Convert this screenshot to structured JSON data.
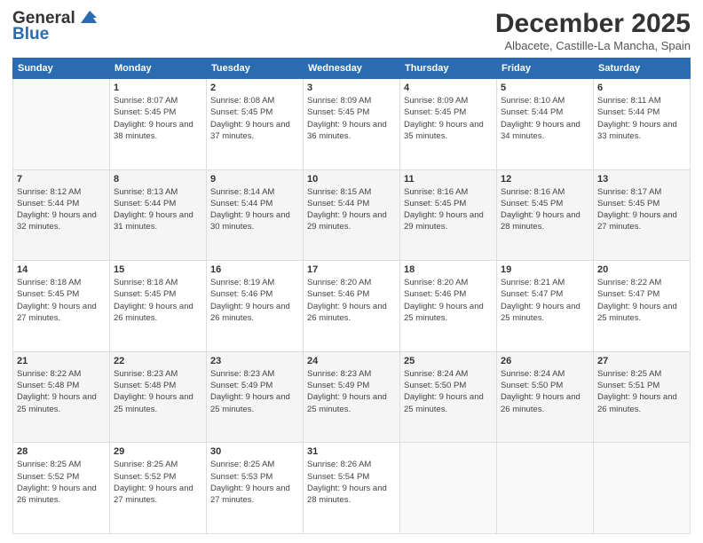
{
  "header": {
    "logo_line1": "General",
    "logo_line2": "Blue",
    "month_title": "December 2025",
    "location": "Albacete, Castille-La Mancha, Spain"
  },
  "weekdays": [
    "Sunday",
    "Monday",
    "Tuesday",
    "Wednesday",
    "Thursday",
    "Friday",
    "Saturday"
  ],
  "weeks": [
    [
      {
        "day": "",
        "sunrise": "",
        "sunset": "",
        "daylight": "",
        "empty": true
      },
      {
        "day": "1",
        "sunrise": "8:07 AM",
        "sunset": "5:45 PM",
        "daylight": "9 hours and 38 minutes."
      },
      {
        "day": "2",
        "sunrise": "8:08 AM",
        "sunset": "5:45 PM",
        "daylight": "9 hours and 37 minutes."
      },
      {
        "day": "3",
        "sunrise": "8:09 AM",
        "sunset": "5:45 PM",
        "daylight": "9 hours and 36 minutes."
      },
      {
        "day": "4",
        "sunrise": "8:09 AM",
        "sunset": "5:45 PM",
        "daylight": "9 hours and 35 minutes."
      },
      {
        "day": "5",
        "sunrise": "8:10 AM",
        "sunset": "5:44 PM",
        "daylight": "9 hours and 34 minutes."
      },
      {
        "day": "6",
        "sunrise": "8:11 AM",
        "sunset": "5:44 PM",
        "daylight": "9 hours and 33 minutes."
      }
    ],
    [
      {
        "day": "7",
        "sunrise": "8:12 AM",
        "sunset": "5:44 PM",
        "daylight": "9 hours and 32 minutes."
      },
      {
        "day": "8",
        "sunrise": "8:13 AM",
        "sunset": "5:44 PM",
        "daylight": "9 hours and 31 minutes."
      },
      {
        "day": "9",
        "sunrise": "8:14 AM",
        "sunset": "5:44 PM",
        "daylight": "9 hours and 30 minutes."
      },
      {
        "day": "10",
        "sunrise": "8:15 AM",
        "sunset": "5:44 PM",
        "daylight": "9 hours and 29 minutes."
      },
      {
        "day": "11",
        "sunrise": "8:16 AM",
        "sunset": "5:45 PM",
        "daylight": "9 hours and 29 minutes."
      },
      {
        "day": "12",
        "sunrise": "8:16 AM",
        "sunset": "5:45 PM",
        "daylight": "9 hours and 28 minutes."
      },
      {
        "day": "13",
        "sunrise": "8:17 AM",
        "sunset": "5:45 PM",
        "daylight": "9 hours and 27 minutes."
      }
    ],
    [
      {
        "day": "14",
        "sunrise": "8:18 AM",
        "sunset": "5:45 PM",
        "daylight": "9 hours and 27 minutes."
      },
      {
        "day": "15",
        "sunrise": "8:18 AM",
        "sunset": "5:45 PM",
        "daylight": "9 hours and 26 minutes."
      },
      {
        "day": "16",
        "sunrise": "8:19 AM",
        "sunset": "5:46 PM",
        "daylight": "9 hours and 26 minutes."
      },
      {
        "day": "17",
        "sunrise": "8:20 AM",
        "sunset": "5:46 PM",
        "daylight": "9 hours and 26 minutes."
      },
      {
        "day": "18",
        "sunrise": "8:20 AM",
        "sunset": "5:46 PM",
        "daylight": "9 hours and 25 minutes."
      },
      {
        "day": "19",
        "sunrise": "8:21 AM",
        "sunset": "5:47 PM",
        "daylight": "9 hours and 25 minutes."
      },
      {
        "day": "20",
        "sunrise": "8:22 AM",
        "sunset": "5:47 PM",
        "daylight": "9 hours and 25 minutes."
      }
    ],
    [
      {
        "day": "21",
        "sunrise": "8:22 AM",
        "sunset": "5:48 PM",
        "daylight": "9 hours and 25 minutes."
      },
      {
        "day": "22",
        "sunrise": "8:23 AM",
        "sunset": "5:48 PM",
        "daylight": "9 hours and 25 minutes."
      },
      {
        "day": "23",
        "sunrise": "8:23 AM",
        "sunset": "5:49 PM",
        "daylight": "9 hours and 25 minutes."
      },
      {
        "day": "24",
        "sunrise": "8:23 AM",
        "sunset": "5:49 PM",
        "daylight": "9 hours and 25 minutes."
      },
      {
        "day": "25",
        "sunrise": "8:24 AM",
        "sunset": "5:50 PM",
        "daylight": "9 hours and 25 minutes."
      },
      {
        "day": "26",
        "sunrise": "8:24 AM",
        "sunset": "5:50 PM",
        "daylight": "9 hours and 26 minutes."
      },
      {
        "day": "27",
        "sunrise": "8:25 AM",
        "sunset": "5:51 PM",
        "daylight": "9 hours and 26 minutes."
      }
    ],
    [
      {
        "day": "28",
        "sunrise": "8:25 AM",
        "sunset": "5:52 PM",
        "daylight": "9 hours and 26 minutes."
      },
      {
        "day": "29",
        "sunrise": "8:25 AM",
        "sunset": "5:52 PM",
        "daylight": "9 hours and 27 minutes."
      },
      {
        "day": "30",
        "sunrise": "8:25 AM",
        "sunset": "5:53 PM",
        "daylight": "9 hours and 27 minutes."
      },
      {
        "day": "31",
        "sunrise": "8:26 AM",
        "sunset": "5:54 PM",
        "daylight": "9 hours and 28 minutes."
      },
      {
        "day": "",
        "sunrise": "",
        "sunset": "",
        "daylight": "",
        "empty": true
      },
      {
        "day": "",
        "sunrise": "",
        "sunset": "",
        "daylight": "",
        "empty": true
      },
      {
        "day": "",
        "sunrise": "",
        "sunset": "",
        "daylight": "",
        "empty": true
      }
    ]
  ]
}
